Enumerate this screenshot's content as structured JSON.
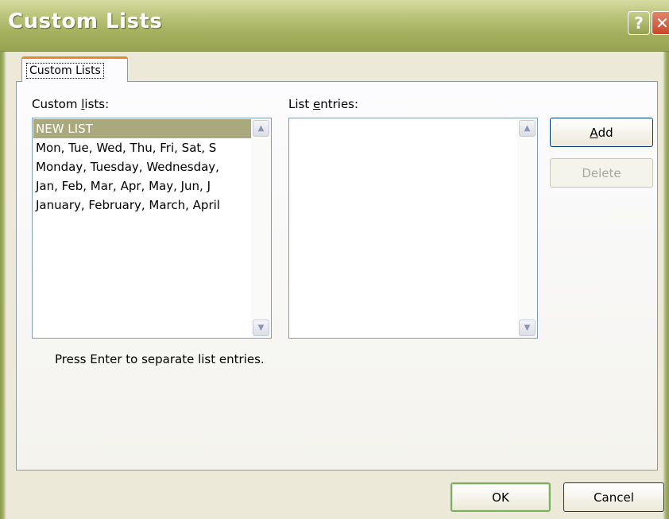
{
  "window": {
    "title": "Custom Lists",
    "help_glyph": "?",
    "close_glyph": "✕"
  },
  "tabs": [
    {
      "label": "Custom Lists",
      "active": true
    }
  ],
  "custom_lists": {
    "label_pre": "Custom ",
    "label_accel": "l",
    "label_post": "ists:",
    "items": [
      "NEW LIST",
      "Mon, Tue, Wed, Thu, Fri, Sat, S",
      "Monday, Tuesday, Wednesday,",
      "Jan, Feb, Mar, Apr, May, Jun, J",
      "January, February, March, April"
    ],
    "selected_index": 0
  },
  "list_entries": {
    "label_pre": "List ",
    "label_accel": "e",
    "label_post": "ntries:",
    "value": ""
  },
  "buttons": {
    "add_accel": "A",
    "add_rest": "dd",
    "delete": "Delete",
    "ok": "OK",
    "cancel": "Cancel"
  },
  "hint": "Press Enter to separate list entries.",
  "icons": {
    "scroll_up": "▲",
    "scroll_down": "▼"
  },
  "colors": {
    "selection": "#a9a97d",
    "title_bar": "#a4b05d",
    "tab_highlight": "#e68b2c"
  }
}
